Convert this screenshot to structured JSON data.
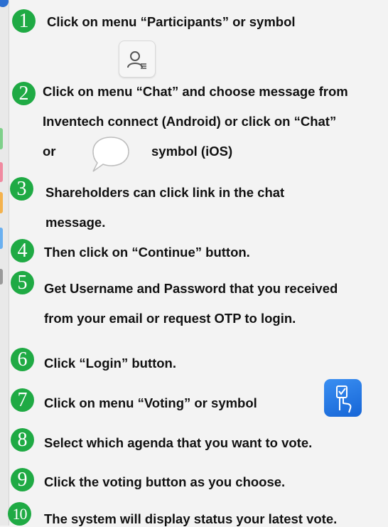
{
  "steps": [
    {
      "number": "1",
      "lines": [
        "Click on menu “Participants” or symbol"
      ]
    },
    {
      "number": "2",
      "lines": [
        "Click on menu “Chat” and choose message from",
        "Inventech connect (Android) or click on “Chat”",
        "or",
        "symbol (iOS)"
      ]
    },
    {
      "number": "3",
      "lines": [
        "Shareholders can click link in the chat",
        "message."
      ]
    },
    {
      "number": "4",
      "lines": [
        "Then click on “Continue” button."
      ]
    },
    {
      "number": "5",
      "lines": [
        "Get Username and Password that you received",
        "from your email or request OTP to login."
      ]
    },
    {
      "number": "6",
      "lines": [
        "Click “Login” button."
      ]
    },
    {
      "number": "7",
      "lines": [
        "Click on menu “Voting” or symbol"
      ]
    },
    {
      "number": "8",
      "lines": [
        "Select which agenda that you want to vote."
      ]
    },
    {
      "number": "9",
      "lines": [
        "Click the voting button as you choose."
      ]
    },
    {
      "number": "10",
      "lines": [
        "The system will display status your latest vote."
      ]
    }
  ],
  "icons": {
    "participants": "participants-icon",
    "chat": "chat-bubble-icon",
    "voting": "voting-icon"
  },
  "colors": {
    "badge": "#1faa44",
    "voting_icon": "#1f78e6",
    "background": "#f3f3f3"
  }
}
